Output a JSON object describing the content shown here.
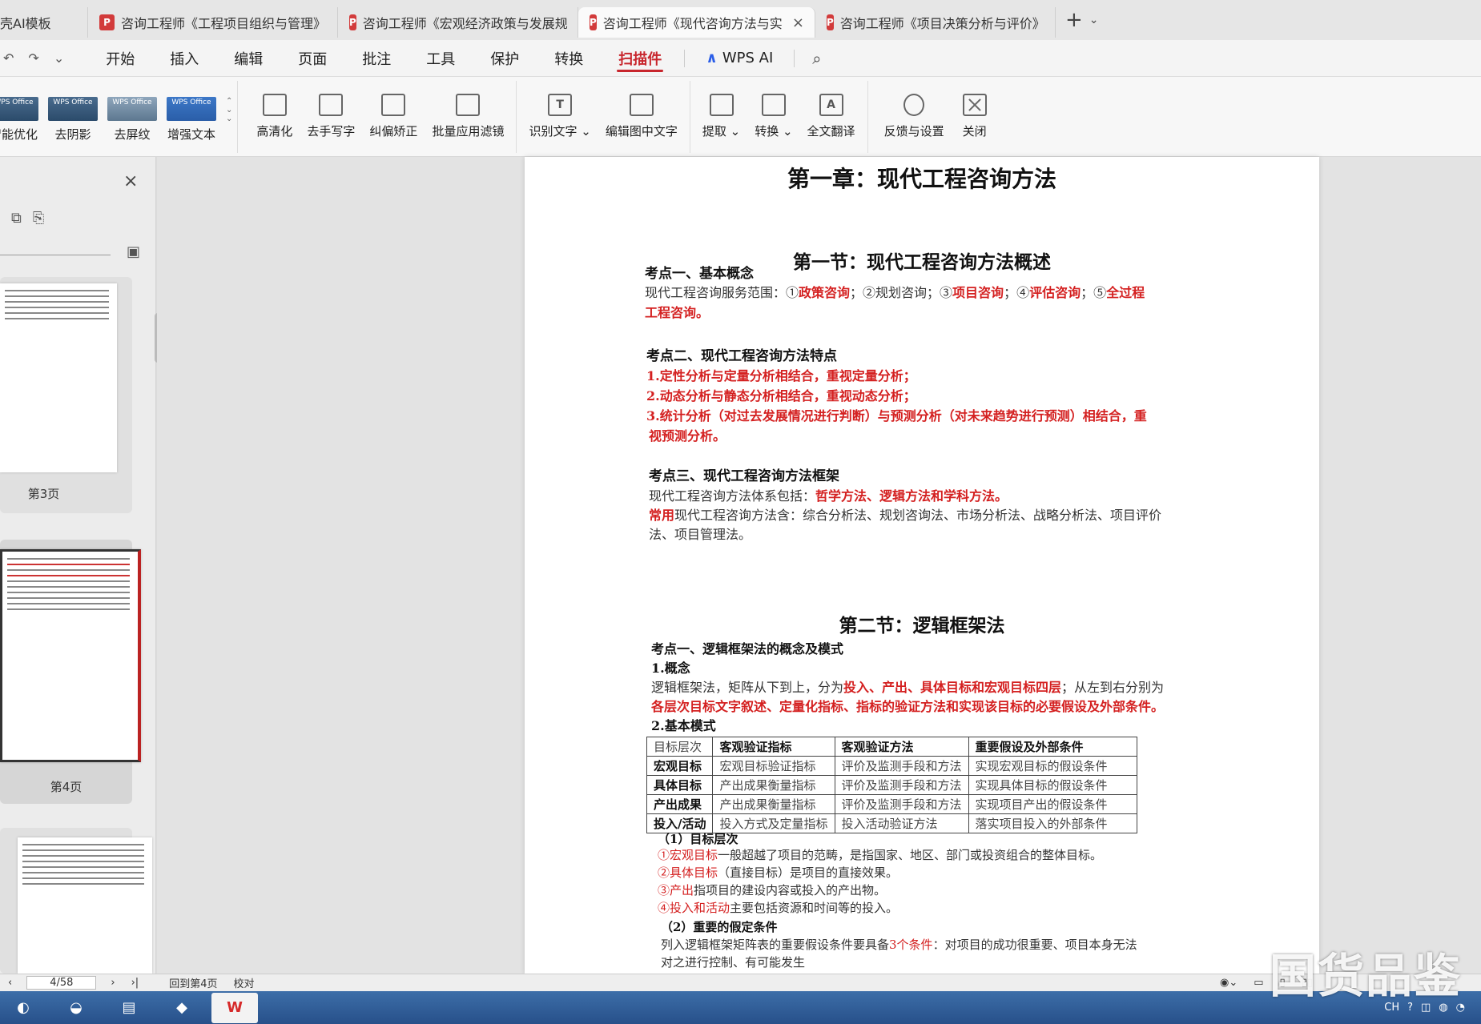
{
  "tabs": [
    {
      "label": "壳AI模板",
      "has_pdf_icon": false,
      "active": false
    },
    {
      "label": "咨询工程师《工程项目组织与管理》",
      "has_pdf_icon": true,
      "active": false
    },
    {
      "label": "咨询工程师《宏观经济政策与发展规",
      "has_pdf_icon": true,
      "active": false
    },
    {
      "label": "咨询工程师《现代咨询方法与实",
      "has_pdf_icon": true,
      "active": true
    },
    {
      "label": "咨询工程师《项目决策分析与评价》",
      "has_pdf_icon": true,
      "active": false
    }
  ],
  "menu": {
    "items": [
      "开始",
      "插入",
      "编辑",
      "页面",
      "批注",
      "工具",
      "保护",
      "转换",
      "扫描件"
    ],
    "active": "扫描件",
    "wps_ai": "WPS AI"
  },
  "ribbon": {
    "gallery": [
      {
        "thumb": "WPS Office",
        "label": "智能优化"
      },
      {
        "thumb": "WPS Office",
        "label": "去阴影"
      },
      {
        "thumb": "WPS Office",
        "label": "去屏纹"
      },
      {
        "thumb": "WPS Office",
        "label": "增强文本"
      }
    ],
    "group1": [
      "高清化",
      "去手写字",
      "纠偏矫正",
      "批量应用滤镜"
    ],
    "group2": [
      "识别文字",
      "编辑图中文字"
    ],
    "group3": [
      "提取",
      "转换",
      "全文翻译"
    ],
    "group4": [
      "反馈与设置",
      "关闭"
    ]
  },
  "left_panel": {
    "page3_label": "第3页",
    "page4_label": "第4页"
  },
  "document": {
    "chapter_title": "第一章：现代工程咨询方法",
    "section1_title": "第一节：现代工程咨询方法概述",
    "kd1_title": "考点一、基本概念",
    "kd1_line1_prefix": "现代工程咨询服务范围：①",
    "kd1_a": "政策咨询",
    "kd1_b": "；②规划咨询；③",
    "kd1_c": "项目咨询",
    "kd1_d": "；④",
    "kd1_e": "评估咨询",
    "kd1_f": "；⑤",
    "kd1_g": "全过程",
    "kd1_line2": "工程咨询。",
    "kd2_title": "考点二、现代工程咨询方法特点",
    "kd2_1": "1.定性分析与定量分析相结合，重视定量分析；",
    "kd2_2": "2.动态分析与静态分析相结合，重视动态分析；",
    "kd2_3a": "3.统计分析（对过去发展情况进行判断）与预测分析（对未来趋势进行预测）相结合，重",
    "kd2_3b": "视预测分析。",
    "kd3_title": "考点三、现代工程咨询方法框架",
    "kd3_l1_prefix": "现代工程咨询方法体系包括：",
    "kd3_l1_red": "哲学方法、逻辑方法和学科方法。",
    "kd3_l2_red": "常用",
    "kd3_l2_rest": "现代工程咨询方法含：综合分析法、规划咨询法、市场分析法、战略分析法、项目评价",
    "kd3_l3": "法、项目管理法。",
    "section2_title": "第二节：逻辑框架法",
    "s2_kd1_title": "考点一、逻辑框架法的概念及模式",
    "s2_concept": "1.概念",
    "s2_c_prefix": "逻辑框架法，矩阵从下到上，分为",
    "s2_c_red": "投入、产出、具体目标和宏观目标四层",
    "s2_c_rest": "；从左到右分别为",
    "s2_c_line2": "各层次目标文字叙述、定量化指标、指标的验证方法和实现该目标的必要假设及外部条件。",
    "s2_mode": "2.基本模式",
    "table": {
      "headers": [
        "目标层次",
        "客观验证指标",
        "客观验证方法",
        "重要假设及外部条件"
      ],
      "rows": [
        [
          "宏观目标",
          "宏观目标验证指标",
          "评价及监测手段和方法",
          "实现宏观目标的假设条件"
        ],
        [
          "具体目标",
          "产出成果衡量指标",
          "评价及监测手段和方法",
          "实现具体目标的假设条件"
        ],
        [
          "产出成果",
          "产出成果衡量指标",
          "评价及监测手段和方法",
          "实现项目产出的假设条件"
        ],
        [
          "投入/活动",
          "投入方式及定量指标",
          "投入活动验证方法",
          "落实项目投入的外部条件"
        ]
      ]
    },
    "lv_title": "（1）目标层次",
    "lv1_red": "①宏观目标",
    "lv1_rest": "一般超越了项目的范畴，是指国家、地区、部门或投资组合的整体目标。",
    "lv2_red": "②具体目标",
    "lv2_rest": "（直接目标）是项目的直接效果。",
    "lv3_red": "③产出",
    "lv3_rest": "指项目的建设内容或投入的产出物。",
    "lv4_red": "④投入和活动",
    "lv4_rest": "主要包括资源和时间等的投入。",
    "assume_title": "（2）重要的假定条件",
    "assume_prefix": "列入逻辑框架矩阵表的重要假设条件要具备",
    "assume_red": "3个条件",
    "assume_rest": "：对项目的成功很重要、项目本身无法",
    "assume_cut": "对之进行控制、有可能发生"
  },
  "statusbar": {
    "page_indicator": "4/58",
    "goto": "回到第4页",
    "proofread": "校对"
  },
  "watermark": "国货品鉴",
  "tray_lang": "CH",
  "colors": {
    "accent_red": "#d42020",
    "menu_active": "#c8262d"
  }
}
